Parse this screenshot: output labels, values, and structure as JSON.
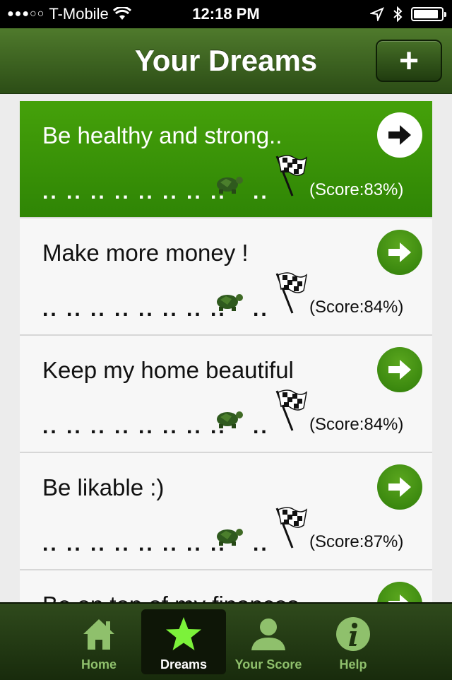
{
  "status_bar": {
    "signal": "●●●○○",
    "carrier": "T-Mobile",
    "time": "12:18 PM",
    "icons": [
      "wifi-icon",
      "location-icon",
      "bluetooth-icon",
      "battery-icon"
    ]
  },
  "nav": {
    "title": "Your Dreams",
    "add_label": "+"
  },
  "dreams": [
    {
      "title": "Be healthy and strong..",
      "progress": ".. .. .. .. .. .. .. ..",
      "trail": "..",
      "score": "(Score:83%)",
      "selected": true
    },
    {
      "title": "Make more money !",
      "progress": ".. .. .. .. .. .. .. ..",
      "trail": "..",
      "score": "(Score:84%)",
      "selected": false
    },
    {
      "title": "Keep my home beautiful",
      "progress": ".. .. .. .. .. .. .. ..",
      "trail": "..",
      "score": "(Score:84%)",
      "selected": false
    },
    {
      "title": "Be likable :)",
      "progress": ".. .. .. .. .. .. .. ..",
      "trail": "..",
      "score": "(Score:87%)",
      "selected": false
    },
    {
      "title": "Be on top of my finances",
      "progress": "",
      "trail": "",
      "score": "",
      "selected": false
    }
  ],
  "tabs": [
    {
      "label": "Home",
      "icon": "home-icon",
      "active": false
    },
    {
      "label": "Dreams",
      "icon": "star-icon",
      "active": true
    },
    {
      "label": "Your Score",
      "icon": "person-icon",
      "active": false
    },
    {
      "label": "Help",
      "icon": "info-icon",
      "active": false
    }
  ],
  "colors": {
    "nav_green": "#3d6320",
    "selected_row": "#3f9a08",
    "tab_label": "#8fc06c",
    "active_star": "#7cf23a"
  }
}
